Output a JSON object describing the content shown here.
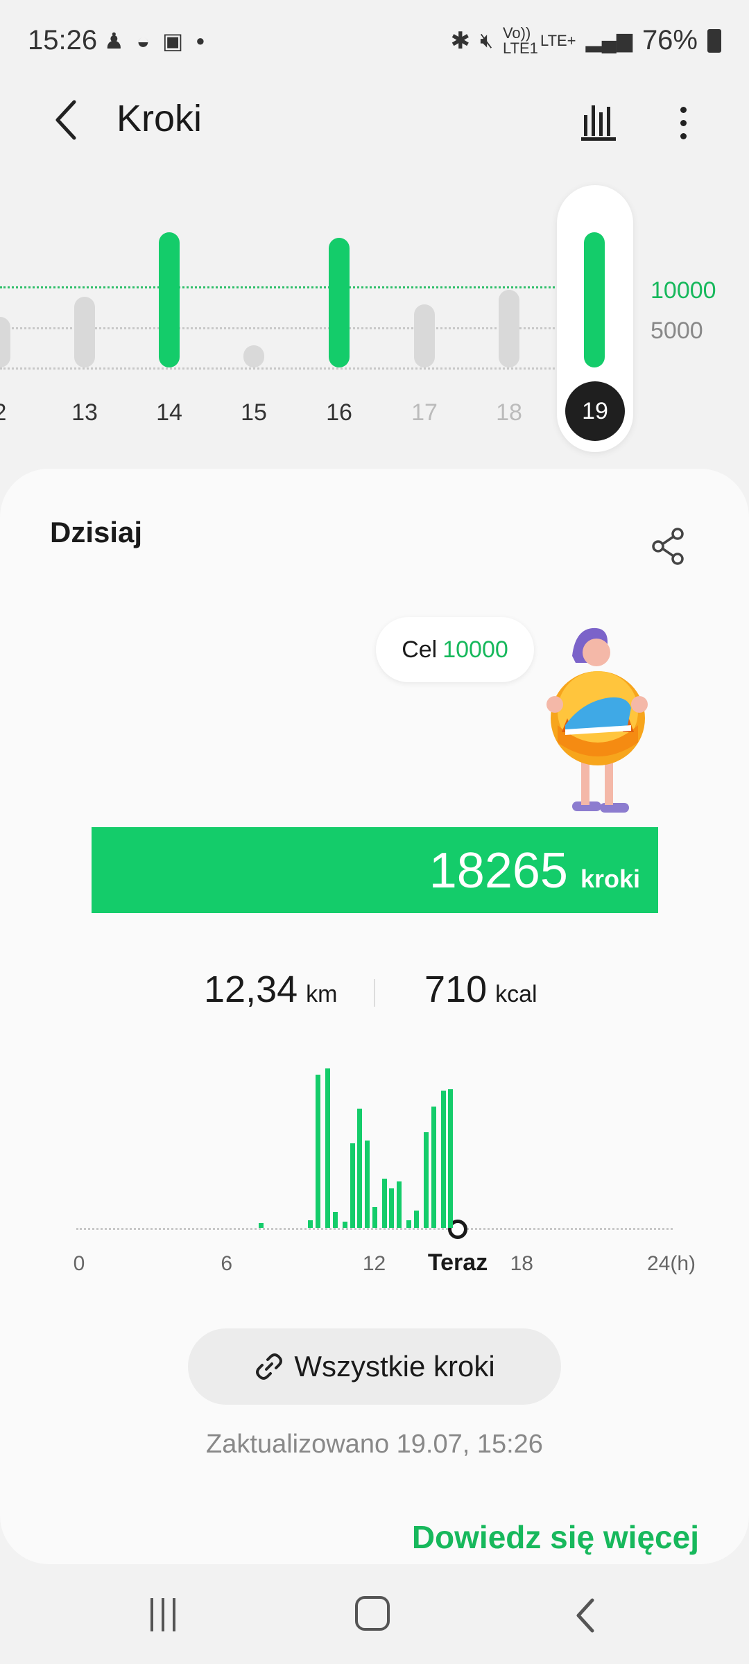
{
  "status_bar": {
    "time": "15:26",
    "left_icons": [
      "notification-icon",
      "planet-icon",
      "image-icon",
      "dot-icon"
    ],
    "right_icons": [
      "bluetooth-icon",
      "mute-icon",
      "volte-icon",
      "lte-icon",
      "signal-icon",
      "battery-icon"
    ],
    "volte_text": "Vo)) LTE1",
    "lte_text": "LTE+",
    "battery": "76%"
  },
  "header": {
    "title": "Kroki"
  },
  "week_chart": {
    "goal_label": "10000",
    "half_label": "5000",
    "days": [
      {
        "label": "2",
        "level": 0.25,
        "status": "below"
      },
      {
        "label": "13",
        "level": 0.43,
        "status": "below"
      },
      {
        "label": "14",
        "level": 1.0,
        "status": "goal"
      },
      {
        "label": "15",
        "level": 0.0,
        "status": "below"
      },
      {
        "label": "16",
        "level": 0.95,
        "status": "goal"
      },
      {
        "label": "17",
        "level": 0.36,
        "status": "future"
      },
      {
        "label": "18",
        "level": 0.49,
        "status": "future"
      },
      {
        "label": "19",
        "level": 1.0,
        "status": "goal",
        "selected": true
      }
    ]
  },
  "today": {
    "title": "Dzisiaj",
    "goal_text": "Cel",
    "goal_value": "10000",
    "steps": "18265",
    "steps_unit": "kroki",
    "progress": 1.0,
    "distance": "12,34",
    "distance_unit": "km",
    "calories": "710",
    "calories_unit": "kcal"
  },
  "hourly_chart": {
    "labels": [
      "0",
      "6",
      "12",
      "Teraz",
      "18",
      "24(h)"
    ],
    "bars": [
      {
        "hour": 7.4,
        "value": 0.03
      },
      {
        "hour": 9.4,
        "value": 0.05
      },
      {
        "hour": 9.7,
        "value": 0.96
      },
      {
        "hour": 10.1,
        "value": 1.0
      },
      {
        "hour": 10.4,
        "value": 0.1
      },
      {
        "hour": 10.8,
        "value": 0.04
      },
      {
        "hour": 11.1,
        "value": 0.53
      },
      {
        "hour": 11.4,
        "value": 0.75
      },
      {
        "hour": 11.7,
        "value": 0.55
      },
      {
        "hour": 12.0,
        "value": 0.13
      },
      {
        "hour": 12.4,
        "value": 0.31
      },
      {
        "hour": 12.7,
        "value": 0.25
      },
      {
        "hour": 13.0,
        "value": 0.29
      },
      {
        "hour": 13.4,
        "value": 0.05
      },
      {
        "hour": 13.7,
        "value": 0.11
      },
      {
        "hour": 14.1,
        "value": 0.6
      },
      {
        "hour": 14.4,
        "value": 0.76
      },
      {
        "hour": 14.8,
        "value": 0.86
      },
      {
        "hour": 15.1,
        "value": 0.87
      }
    ],
    "now_hour": 15.4
  },
  "actions": {
    "all_steps_label": "Wszystkie kroki",
    "updated": "Zaktualizowano 19.07, 15:26",
    "learn_more": "Dowiedz się więcej"
  },
  "colors": {
    "accent": "#14cc6a",
    "goal_text": "#17b85c",
    "inactive_bar": "#d9d9d9"
  }
}
